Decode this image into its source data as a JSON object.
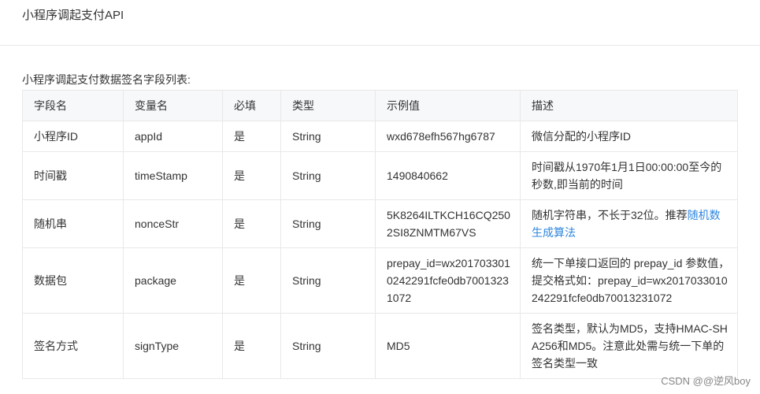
{
  "page": {
    "title": "小程序调起支付API",
    "caption": "小程序调起支付数据签名字段列表:"
  },
  "table": {
    "headers": [
      "字段名",
      "变量名",
      "必填",
      "类型",
      "示例值",
      "描述"
    ],
    "rows": [
      {
        "field": "小程序ID",
        "var": "appId",
        "required": "是",
        "type": "String",
        "example": "wxd678efh567hg6787",
        "desc": "微信分配的小程序ID"
      },
      {
        "field": "时间戳",
        "var": "timeStamp",
        "required": "是",
        "type": "String",
        "example": "1490840662",
        "desc": "时间戳从1970年1月1日00:00:00至今的秒数,即当前的时间"
      },
      {
        "field": "随机串",
        "var": "nonceStr",
        "required": "是",
        "type": "String",
        "example": "5K8264ILTKCH16CQ2502SI8ZNMTM67VS",
        "desc": "随机字符串，不长于32位。推荐",
        "desc_link": "随机数生成算法"
      },
      {
        "field": "数据包",
        "var": "package",
        "required": "是",
        "type": "String",
        "example": "prepay_id=wx2017033010242291fcfe0db70013231072",
        "desc": "统一下单接口返回的 prepay_id 参数值，提交格式如：prepay_id=wx2017033010242291fcfe0db70013231072"
      },
      {
        "field": "签名方式",
        "var": "signType",
        "required": "是",
        "type": "String",
        "example": "MD5",
        "desc": "签名类型，默认为MD5，支持HMAC-SHA256和MD5。注意此处需与统一下单的签名类型一致"
      }
    ]
  },
  "watermark": "CSDN @@逆风boy"
}
